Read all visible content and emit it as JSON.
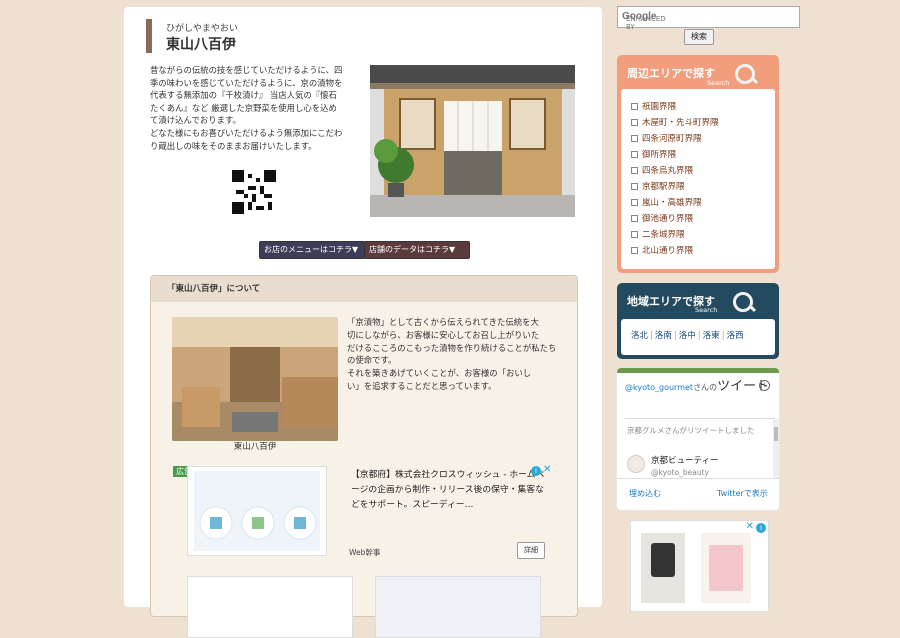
{
  "header": {
    "reading": "ひがしやまやおい",
    "name": "東山八百伊"
  },
  "intro": {
    "lines": [
      "昔ながらの伝統の技を感じていただけるように、四",
      "季の味わいを感じていただけるように、京の漬物を",
      "代表する無添加の『千枚漬け』 当店人気の『懐石",
      "たくあん』など 厳選した京野菜を使用し心を込め",
      "て漬け込んでおります。",
      "どなた様にもお喜びいただけるよう無添加にこだわ",
      "り蔵出しの味をそのままお届けいたします。"
    ]
  },
  "buttons": {
    "menu": "お店のメニューはコチラ▼",
    "data": "店舗のデータはコチラ▼"
  },
  "about": {
    "heading": "「東山八百伊」について",
    "caption": "東山八百伊",
    "lines": [
      "「京漬物」として古くから伝えられてきた伝統を大",
      "切にしながら、お客様に安心してお召し上がりいた",
      "だけるこころのこもった漬物を作り続けることが私たち",
      "の使命です。",
      "それを築きあげていくことが、お客様の「おいし",
      "い」を追求することだと思っています。"
    ]
  },
  "ad": {
    "badge": "広告",
    "title": "【京都府】株式会社クロスウィッシュ - ホームページの企画から制作・リリース後の保守・集客などをサポート。スピーディー…",
    "source": "Web幹事",
    "detail": "詳細",
    "info_icon": "info-icon",
    "close_icon": "close-icon"
  },
  "search": {
    "label": "ENHANCED BY",
    "brand": "Google",
    "button": "検索"
  },
  "area_nearby": {
    "title": "周辺エリアで探す",
    "sub": "Search",
    "items": [
      "祇園界隈",
      "木屋町・先斗町界隈",
      "四条河原町界隈",
      "御所界隈",
      "四条烏丸界隈",
      "京都駅界隈",
      "嵐山・高雄界隈",
      "御池通り界隈",
      "二条城界隈",
      "北山通り界隈"
    ]
  },
  "area_region": {
    "title": "地域エリアで探す",
    "sub": "Search",
    "items": [
      "洛北",
      "洛南",
      "洛中",
      "洛東",
      "洛西"
    ]
  },
  "twitter": {
    "handle": "@kyoto_gourmet",
    "handle_suffix": "さんの",
    "tweet_label": "ツイート",
    "retweet": "京都グルメさんがリツイートしました",
    "user_name": "京都ビューティー",
    "user_handle": "@kyoto_beauty",
    "embed": "埋め込む",
    "view": "Twitterで表示"
  },
  "colors": {
    "page_bg": "#efe1d2",
    "nearby_panel": "#f29d7c",
    "region_panel": "#234a5e",
    "twitter_accent": "#6b9a4a",
    "link": "#1b7ac2"
  }
}
